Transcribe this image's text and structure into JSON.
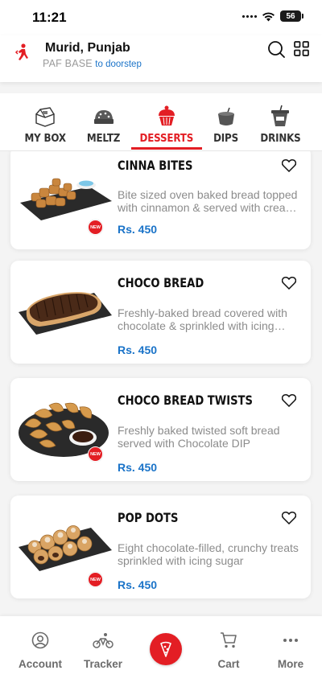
{
  "status_bar": {
    "time": "11:21",
    "battery": "56"
  },
  "header": {
    "location_title": "Murid, Punjab",
    "location_subtitle": "PAF BASE",
    "delivery_mode": "to doorstep"
  },
  "tabs": [
    {
      "label": "MY BOX",
      "icon": "box-icon",
      "active": false
    },
    {
      "label": "MELTZ",
      "icon": "meltz-icon",
      "active": false
    },
    {
      "label": "DESSERTS",
      "icon": "cupcake-icon",
      "active": true
    },
    {
      "label": "DIPS",
      "icon": "dip-cup-icon",
      "active": false
    },
    {
      "label": "DRINKS",
      "icon": "drink-cup-icon",
      "active": false
    }
  ],
  "products": [
    {
      "name": "CINNA BITES",
      "description": "Bite sized oven baked bread topped with cinnamon & served with cream cheese dip",
      "price": "Rs. 450",
      "badge": "NEW"
    },
    {
      "name": "CHOCO BREAD",
      "description": "Freshly-baked bread covered with chocolate & sprinkled with icing sugar",
      "price": "Rs. 450",
      "badge": ""
    },
    {
      "name": "CHOCO BREAD TWISTS",
      "description": "Freshly baked twisted  soft bread served with Chocolate DIP",
      "price": "Rs. 450",
      "badge": "NEW"
    },
    {
      "name": "POP DOTS",
      "description": "Eight chocolate-filled, crunchy treats sprinkled with icing sugar",
      "price": "Rs. 450",
      "badge": "NEW"
    }
  ],
  "bottom_nav": [
    {
      "label": "Account",
      "icon": "account-icon"
    },
    {
      "label": "Tracker",
      "icon": "bike-icon"
    },
    {
      "label": "",
      "icon": "pizza-slice-icon"
    },
    {
      "label": "Cart",
      "icon": "cart-icon"
    },
    {
      "label": "More",
      "icon": "more-dots-icon"
    }
  ],
  "colors": {
    "brand_red": "#e31e24",
    "price_blue": "#1a73c8",
    "text_gray": "#8c8c8c"
  }
}
